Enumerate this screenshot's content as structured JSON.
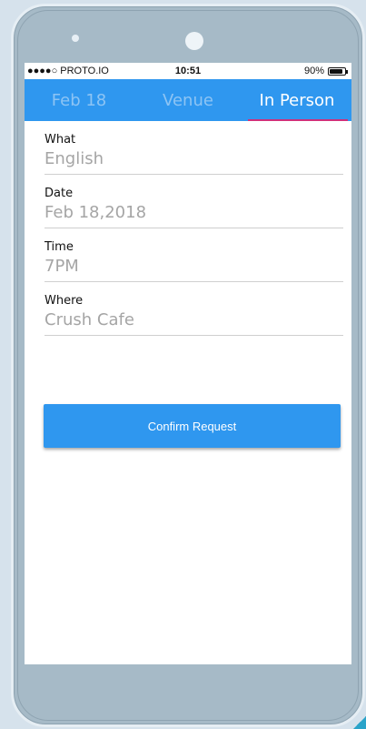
{
  "status_bar": {
    "carrier": "●●●●○ PROTO.IO",
    "time": "10:51",
    "battery": "90%",
    "battery_level": 0.9
  },
  "tabs": [
    {
      "label": "Feb 18",
      "active": false
    },
    {
      "label": "Venue",
      "active": false
    },
    {
      "label": "In Person",
      "active": true
    }
  ],
  "form": {
    "what": {
      "label": "What",
      "value": "English"
    },
    "date": {
      "label": "Date",
      "value": "Feb 18,2018"
    },
    "time": {
      "label": "Time",
      "value": "7PM"
    },
    "where": {
      "label": "Where",
      "value": "Crush Cafe"
    }
  },
  "confirm_label": "Confirm Request",
  "colors": {
    "accent": "#2f97ef",
    "tab_indicator": "#d0307a",
    "frame": "#a6bac7",
    "background": "#d6e2ec"
  }
}
